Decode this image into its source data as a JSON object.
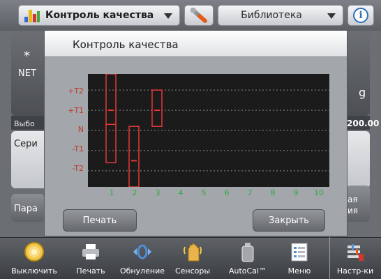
{
  "topbar": {
    "app_name": "Контроль качества",
    "library_label": "Библиотека",
    "info_label": "i"
  },
  "background": {
    "star": "*",
    "net": "NET",
    "unit": "g",
    "select_text": "Выбо",
    "value_text": "200.00",
    "series_text": "Сери",
    "params_text": "Пара",
    "right_text_1": "ая",
    "right_text_2": "ия"
  },
  "dialog": {
    "title": "Контроль качества",
    "print_label": "Печать",
    "close_label": "Закрыть"
  },
  "chart_data": {
    "type": "box",
    "y_categories": [
      "+T2",
      "+T1",
      "N",
      "-T1",
      "-T2"
    ],
    "x_ticks": [
      "1",
      "2",
      "3",
      "4",
      "5",
      "6",
      "7",
      "8",
      "9",
      "10"
    ],
    "ylim": [
      -2.8,
      2.8
    ],
    "grid": "dashed horizontal",
    "boxes": [
      {
        "x": 1,
        "high": 2.9,
        "low": -1.6,
        "mean": 1.0,
        "upper": 2.9,
        "lower": 0.3
      },
      {
        "x": 2,
        "high": 0.2,
        "low": -3.0,
        "mean": -1.5,
        "upper": 0.2,
        "lower": -3.0
      },
      {
        "x": 3,
        "high": 2.0,
        "low": 0.2,
        "mean": 1.0,
        "upper": 2.0,
        "lower": 0.2
      }
    ],
    "colors": {
      "box": "#e53935",
      "y_labels": "#c0392b",
      "x_labels": "#2eaa42",
      "grid": "#8a8a8a",
      "background": "#1b1b1b"
    }
  },
  "toolbar": {
    "items": [
      {
        "label": "Выключить",
        "icon": "power-icon"
      },
      {
        "label": "Печать",
        "icon": "printer-icon"
      },
      {
        "label": "Обнуление",
        "icon": "zero-icon"
      },
      {
        "label": "Сенсоры",
        "icon": "hand-sensor-icon"
      },
      {
        "label": "AutoCal™",
        "icon": "calibration-weight-icon"
      },
      {
        "label": "Меню",
        "icon": "menu-list-icon"
      },
      {
        "label": "Настр-ки",
        "icon": "settings-icon"
      }
    ]
  }
}
